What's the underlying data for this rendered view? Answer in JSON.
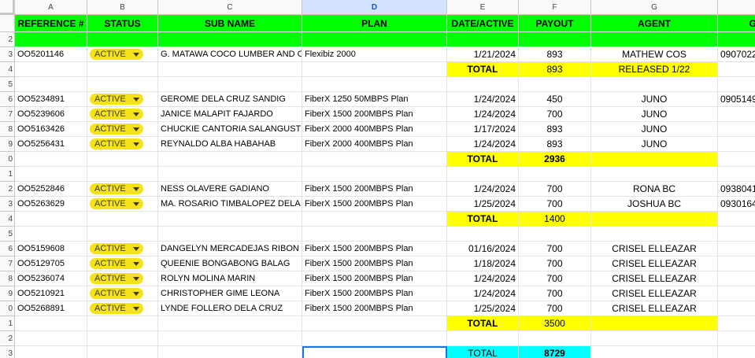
{
  "columns": [
    "A",
    "B",
    "C",
    "D",
    "E",
    "F",
    "G"
  ],
  "selected_column": "D",
  "rows": [
    "",
    "2",
    "3",
    "4",
    "5",
    "6",
    "7",
    "8",
    "9",
    "0",
    "1",
    "2",
    "3",
    "4",
    "5",
    "6",
    "7",
    "8",
    "9",
    "0",
    "1",
    "2",
    "3"
  ],
  "headers": [
    "REFERENCE #",
    "STATUS",
    "SUB NAME",
    "PLAN",
    "DATE/ACTIVE",
    "PAYOUT",
    "AGENT",
    "GC"
  ],
  "status_option": "ACTIVE",
  "groups": [
    {
      "entries": [
        {
          "ref": "OO5201146",
          "name": "G. MATAWA COCO LUMBER AND CON",
          "plan": "Flexibiz 2000",
          "date": "1/21/2024",
          "payout": "893",
          "agent": "MATHEW COS",
          "phone": "0907022"
        }
      ],
      "total_label": "TOTAL",
      "total_value": "893",
      "total_note": "RELEASED 1/22"
    },
    {
      "entries": [
        {
          "ref": "OO5234891",
          "name": "GEROME DELA CRUZ SANDIG",
          "plan": "FiberX 1250 50MBPS Plan",
          "date": "1/24/2024",
          "payout": "450",
          "agent": "JUNO",
          "phone": "0905149"
        },
        {
          "ref": "OO5239606",
          "name": "JANICE MALAPIT FAJARDO",
          "plan": "FiberX 1500 200MBPS Plan",
          "date": "1/24/2024",
          "payout": "700",
          "agent": "JUNO",
          "phone": ""
        },
        {
          "ref": "OO5163426",
          "name": "CHUCKIE CANTORIA SALANGUSTE",
          "plan": "FiberX 2000 400MBPS Plan",
          "date": "1/17/2024",
          "payout": "893",
          "agent": "JUNO",
          "phone": ""
        },
        {
          "ref": "OO5256431",
          "name": "REYNALDO ALBA HABAHAB",
          "plan": "FiberX 2000 400MBPS Plan",
          "date": "1/24/2024",
          "payout": "893",
          "agent": "JUNO",
          "phone": ""
        }
      ],
      "total_label": "TOTAL",
      "total_value": "2936",
      "total_note": ""
    },
    {
      "entries": [
        {
          "ref": "OO5252846",
          "name": "NESS OLAVERE GADIANO",
          "plan": "FiberX 1500 200MBPS Plan",
          "date": "1/24/2024",
          "payout": "700",
          "agent": "RONA BC",
          "phone": "0938041"
        },
        {
          "ref": "OO5263629",
          "name": "MA. ROSARIO TIMBALOPEZ DELA CRU",
          "plan": "FiberX 1500 200MBPS Plan",
          "date": "1/25/2024",
          "payout": "700",
          "agent": "JOSHUA BC",
          "phone": "0930164"
        }
      ],
      "total_label": "TOTAL",
      "total_value": "1400",
      "total_note": ""
    },
    {
      "entries": [
        {
          "ref": "OO5159608",
          "name": "DANGELYN MERCADEJAS RIBON",
          "plan": "FiberX 1500 200MBPS Plan",
          "date": "01/16/2024",
          "payout": "700",
          "agent": "CRISEL ELLEAZAR",
          "phone": ""
        },
        {
          "ref": "OO5129705",
          "name": "QUEENIE BONGABONG BALAG",
          "plan": "FiberX 1500 200MBPS Plan",
          "date": "1/18/2024",
          "payout": "700",
          "agent": "CRISEL ELLEAZAR",
          "phone": ""
        },
        {
          "ref": "OO5236074",
          "name": "ROLYN MOLINA MARIN",
          "plan": "FiberX 1500 200MBPS Plan",
          "date": "1/24/2024",
          "payout": "700",
          "agent": "CRISEL ELLEAZAR",
          "phone": ""
        },
        {
          "ref": "OO5210921",
          "name": "CHRISTOPHER GIME LEONA",
          "plan": "FiberX 1500 200MBPS Plan",
          "date": "1/24/2024",
          "payout": "700",
          "agent": "CRISEL ELLEAZAR",
          "phone": ""
        },
        {
          "ref": "OO5268891",
          "name": "LYNDE FOLLERO DELA CRUZ",
          "plan": "FiberX 1500 200MBPS Plan",
          "date": "1/25/2024",
          "payout": "700",
          "agent": "CRISEL ELLEAZAR",
          "phone": ""
        }
      ],
      "total_label": "TOTAL",
      "total_value": "3500",
      "total_note": ""
    }
  ],
  "grand_total": {
    "label": "TOTAL",
    "value": "8729"
  },
  "colors": {
    "header_green": "#00ff00",
    "total_yellow": "#ffff00",
    "grand_total_cyan": "#00ffff",
    "status_chip": "#f6e21b",
    "selection": "#1a73e8"
  }
}
